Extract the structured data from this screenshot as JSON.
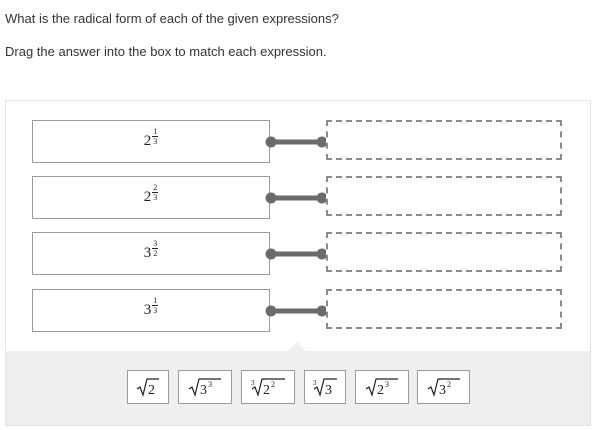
{
  "question": "What is the radical form of each of the given expressions?",
  "instruction": "Drag the answer into the box to match each expression.",
  "expressions": [
    {
      "base": "2",
      "numerator": "1",
      "denominator": "3"
    },
    {
      "base": "2",
      "numerator": "2",
      "denominator": "3"
    },
    {
      "base": "3",
      "numerator": "3",
      "denominator": "2"
    },
    {
      "base": "3",
      "numerator": "1",
      "denominator": "3"
    }
  ],
  "answers": [
    {
      "index": "",
      "radicand": "2",
      "exponent": ""
    },
    {
      "index": "",
      "radicand": "3",
      "exponent": "3"
    },
    {
      "index": "3",
      "radicand": "2",
      "exponent": "2"
    },
    {
      "index": "3",
      "radicand": "3",
      "exponent": ""
    },
    {
      "index": "",
      "radicand": "2",
      "exponent": "3"
    },
    {
      "index": "",
      "radicand": "3",
      "exponent": "2"
    }
  ],
  "colors": {
    "connector": "#6b6b6b",
    "border": "#9b9b9b",
    "bank_bg": "#efefef"
  }
}
